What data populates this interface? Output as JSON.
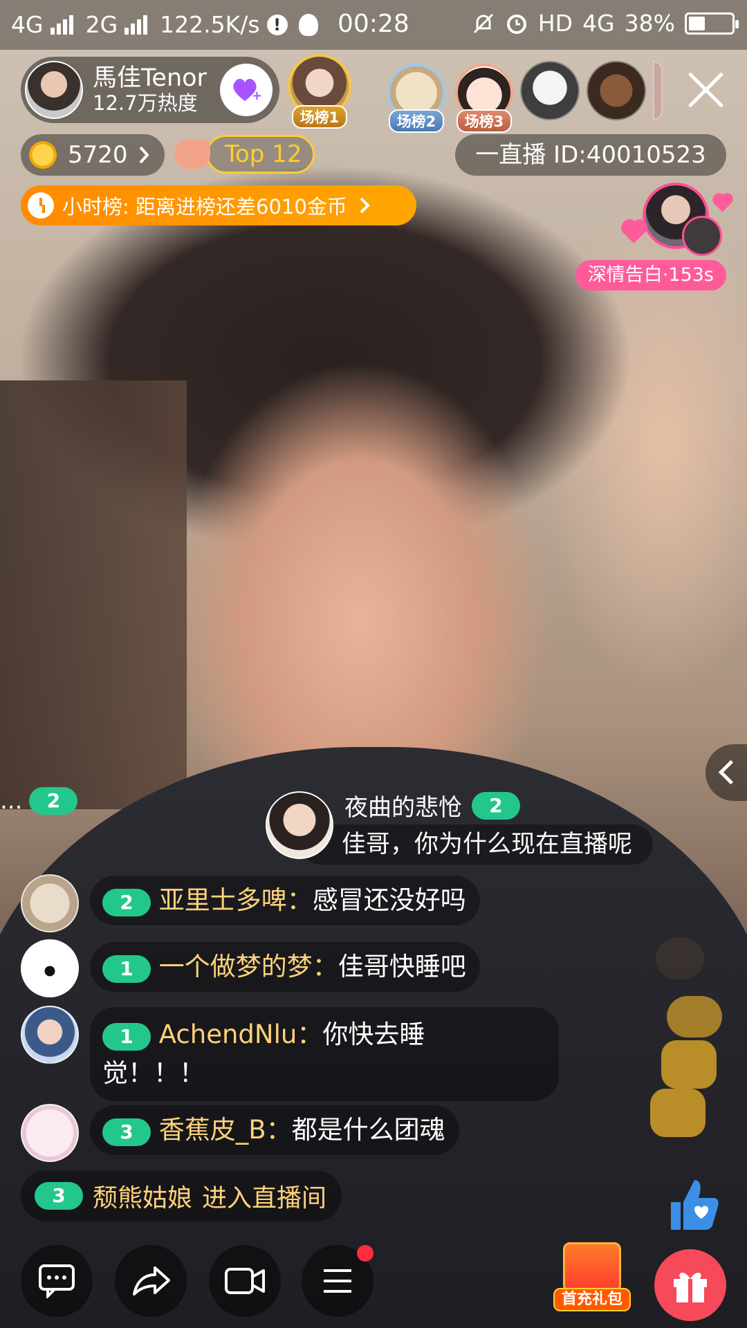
{
  "status_bar": {
    "net1": "4G",
    "net2": "2G",
    "speed": "122.5K/s",
    "time": "00:28",
    "hd": "HD",
    "net3": "4G",
    "battery": "38%",
    "battery_level": 0.38
  },
  "host": {
    "name": "馬佳Tenor",
    "heat": "12.7万热度"
  },
  "ranks": [
    "场榜1",
    "场榜2",
    "场榜3"
  ],
  "coins": {
    "amount": "5720",
    "top": "Top 12"
  },
  "room_id": "一直播 ID:40010523",
  "hourly": "小时榜: 距离进榜还差6010金币",
  "confession": "深情告白·153s",
  "chat": {
    "truncated_level": "2",
    "truncated_prefix": "...",
    "featured": {
      "user": "夜曲的悲怆",
      "level": "2",
      "text": "佳哥，你为什么现在直播呢"
    },
    "messages": [
      {
        "level": "2",
        "user": "亚里士多啤：",
        "text": "感冒还没好吗"
      },
      {
        "level": "1",
        "user": "一个做梦的梦：",
        "text": "佳哥快睡吧"
      },
      {
        "level": "1",
        "user": "AchendNlu：",
        "text": "你快去睡",
        "text2": "觉！！！"
      },
      {
        "level": "3",
        "user": "香蕉皮_B：",
        "text": "都是什么团魂"
      }
    ],
    "join": {
      "level": "3",
      "user": "颓熊姑娘",
      "text": "进入直播间"
    }
  },
  "bottom": {
    "first_recharge": "首充礼包"
  },
  "colors": {
    "level_green": "#23c78c",
    "name_gold": "#ffd27a",
    "hour_orange": "#ff8a00",
    "confess_pink": "#ff5a9a",
    "gift_red": "#f6495a"
  },
  "icons": [
    "signal-icon",
    "exclamation-icon",
    "vpn-icon",
    "mute-icon",
    "alarm-icon",
    "battery-icon",
    "follow-heart-icon",
    "close-icon",
    "coin-icon",
    "hand-icon",
    "clock-icon",
    "chevron-right-icon",
    "chevron-left-icon",
    "chat-icon",
    "share-icon",
    "camera-icon",
    "menu-icon",
    "gift-icon",
    "thumbs-up-icon"
  ]
}
